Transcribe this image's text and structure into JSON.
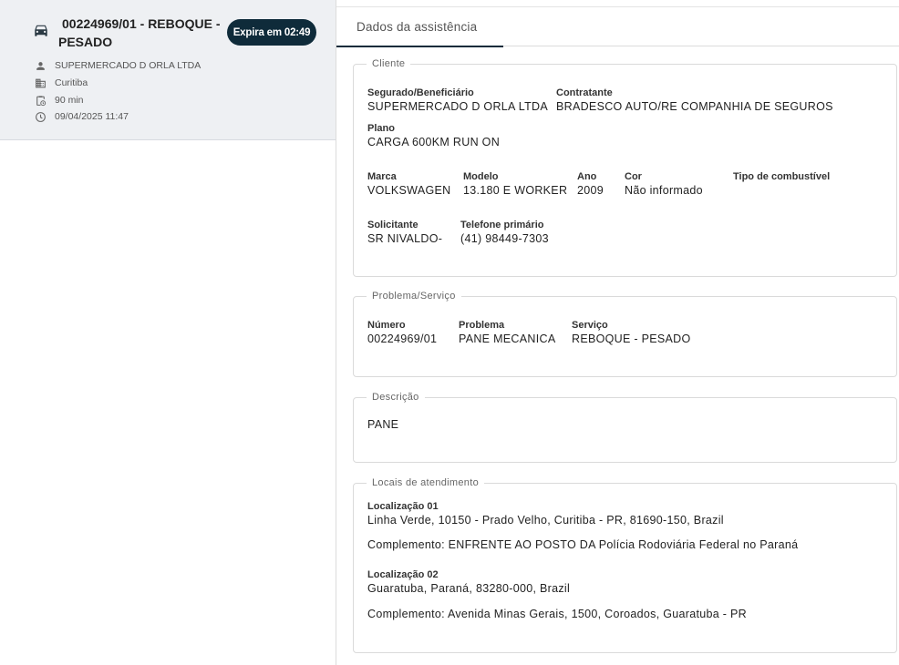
{
  "card": {
    "title_line1": "00224969/01 - REBOQUE -",
    "title_line2": "PESADO",
    "badge": "Expira em 02:49",
    "client": "SUPERMERCADO D ORLA LTDA",
    "city": "Curitiba",
    "duration": "90 min",
    "datetime": "09/04/2025 11:47"
  },
  "tabs": [
    {
      "label": "Dados da assistência",
      "active": true
    }
  ],
  "cliente": {
    "legend": "Cliente",
    "segurado_label": "Segurado/Beneficiário",
    "segurado_value": "SUPERMERCADO D ORLA LTDA",
    "contratante_label": "Contratante",
    "contratante_value": "BRADESCO AUTO/RE COMPANHIA DE SEGUROS",
    "plano_label": "Plano",
    "plano_value": "CARGA 600KM RUN ON",
    "marca_label": "Marca",
    "marca_value": "VOLKSWAGEN",
    "modelo_label": "Modelo",
    "modelo_value": "13.180 E WORKER",
    "ano_label": "Ano",
    "ano_value": "2009",
    "cor_label": "Cor",
    "cor_value": "Não informado",
    "combustivel_label": "Tipo de combustível",
    "combustivel_value": "",
    "solicitante_label": "Solicitante",
    "solicitante_value": "SR NIVALDO-",
    "telefone_label": "Telefone primário",
    "telefone_value": "(41) 98449-7303"
  },
  "problema": {
    "legend": "Problema/Serviço",
    "numero_label": "Número",
    "numero_value": "00224969/01",
    "problema_label": "Problema",
    "problema_value": "PANE MECANICA",
    "servico_label": "Serviço",
    "servico_value": "REBOQUE - PESADO"
  },
  "descricao": {
    "legend": "Descrição",
    "text": "PANE"
  },
  "locais": {
    "legend": "Locais de atendimento",
    "loc1_label": "Localização 01",
    "loc1_value": "Linha Verde, 10150 - Prado Velho, Curitiba - PR, 81690-150, Brazil",
    "loc1_complemento": "Complemento: ENFRENTE AO POSTO DA Polícia Rodoviária Federal no Paraná",
    "loc2_label": "Localização 02",
    "loc2_value": "Guaratuba, Paraná, 83280-000, Brazil",
    "loc2_complemento": "Complemento: Avenida Minas Gerais, 1500, Coroados, Guaratuba - PR"
  },
  "colors": {
    "badge_bg": "#0f2b3a",
    "card_bg": "#eef0f3",
    "tab_indicator": "#0f2b3a"
  }
}
